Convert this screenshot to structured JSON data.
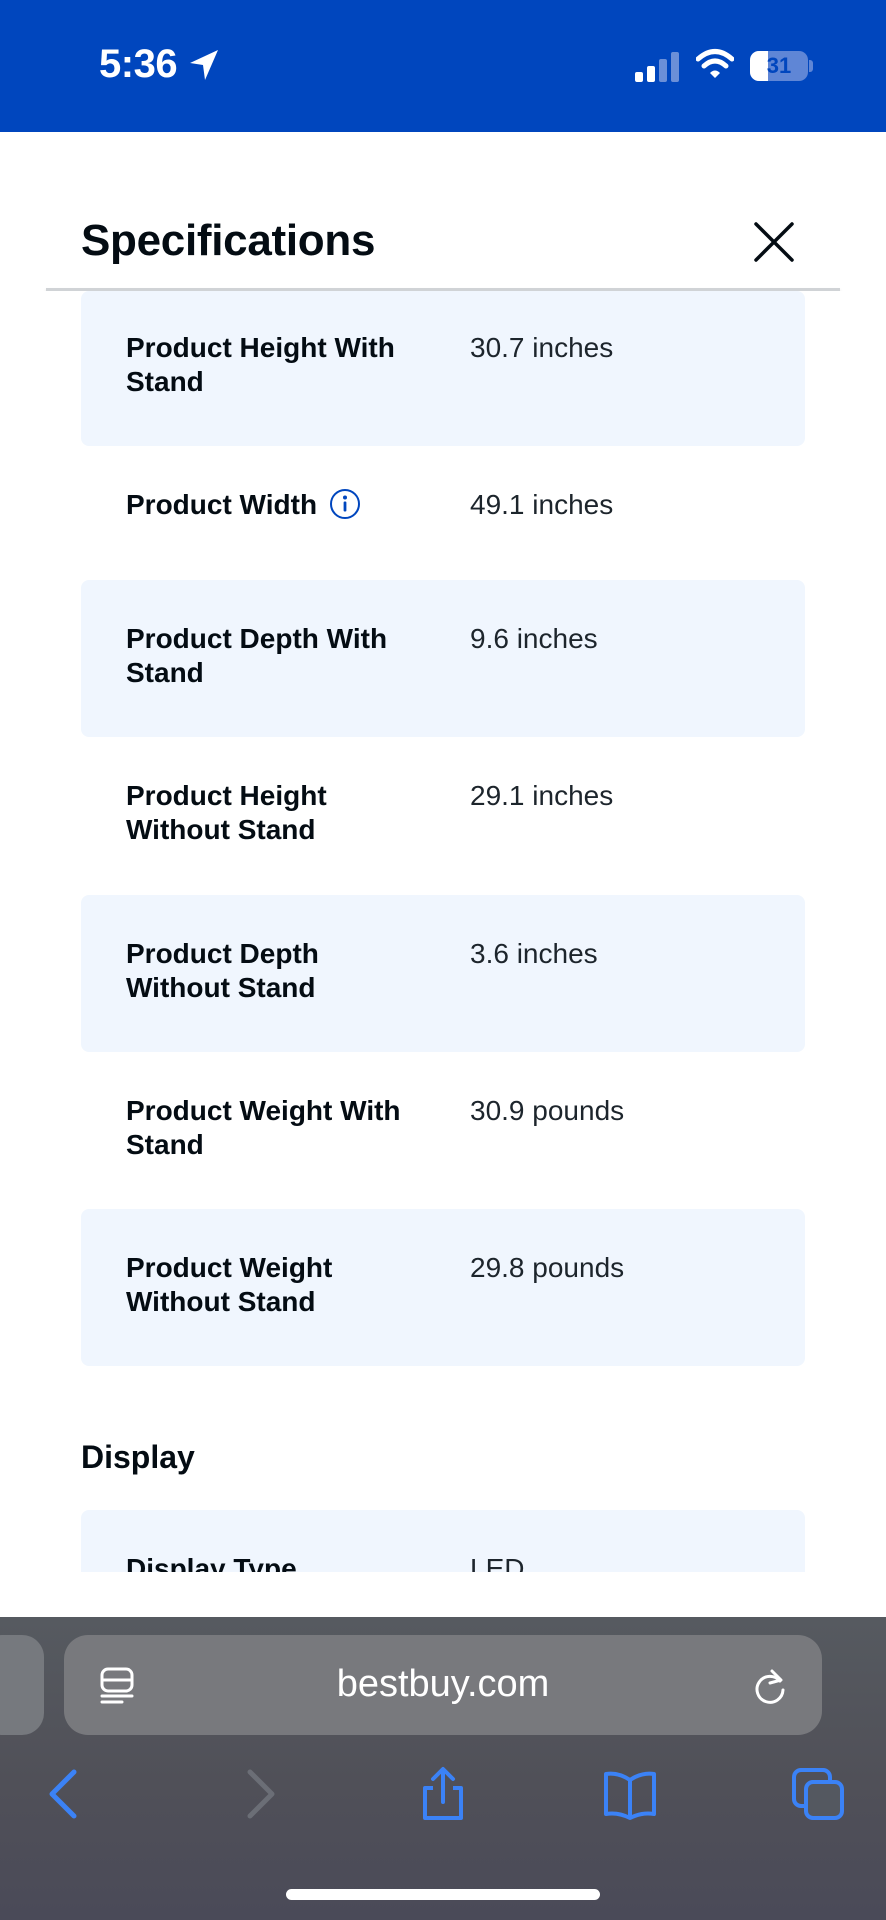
{
  "status_bar": {
    "time": "5:36",
    "battery_level": 31,
    "battery_label": "31",
    "icons": [
      "location-arrow-icon",
      "cellular-signal-icon",
      "wifi-icon",
      "battery-icon"
    ]
  },
  "sheet": {
    "title": "Specifications",
    "close_icon": "close-icon"
  },
  "specs": [
    {
      "label": "Product Height With Stand",
      "value": "30.7 inches",
      "shaded": true
    },
    {
      "label": "Product Width",
      "value": "49.1 inches",
      "shaded": false,
      "info_icon": "info-icon"
    },
    {
      "label": "Product Depth With Stand",
      "value": "9.6 inches",
      "shaded": true
    },
    {
      "label": "Product Height Without Stand",
      "value": "29.1 inches",
      "shaded": false
    },
    {
      "label": "Product Depth Without Stand",
      "value": "3.6 inches",
      "shaded": true
    },
    {
      "label": "Product Weight With Stand",
      "value": "30.9 pounds",
      "shaded": false
    },
    {
      "label": "Product Weight Without Stand",
      "value": "29.8 pounds",
      "shaded": true
    }
  ],
  "display_section": {
    "title": "Display",
    "rows": [
      {
        "label": "Display Type",
        "value": "LED",
        "shaded": true
      }
    ]
  },
  "browser": {
    "url": "bestbuy.com",
    "icons": [
      "reader-icon",
      "reload-icon",
      "back-icon",
      "forward-icon",
      "share-icon",
      "bookmarks-icon",
      "tabs-icon"
    ]
  },
  "colors": {
    "brand_blue": "#0046be",
    "row_shade": "#f0f6fe",
    "toolbar_icon": "#3b82f6"
  }
}
